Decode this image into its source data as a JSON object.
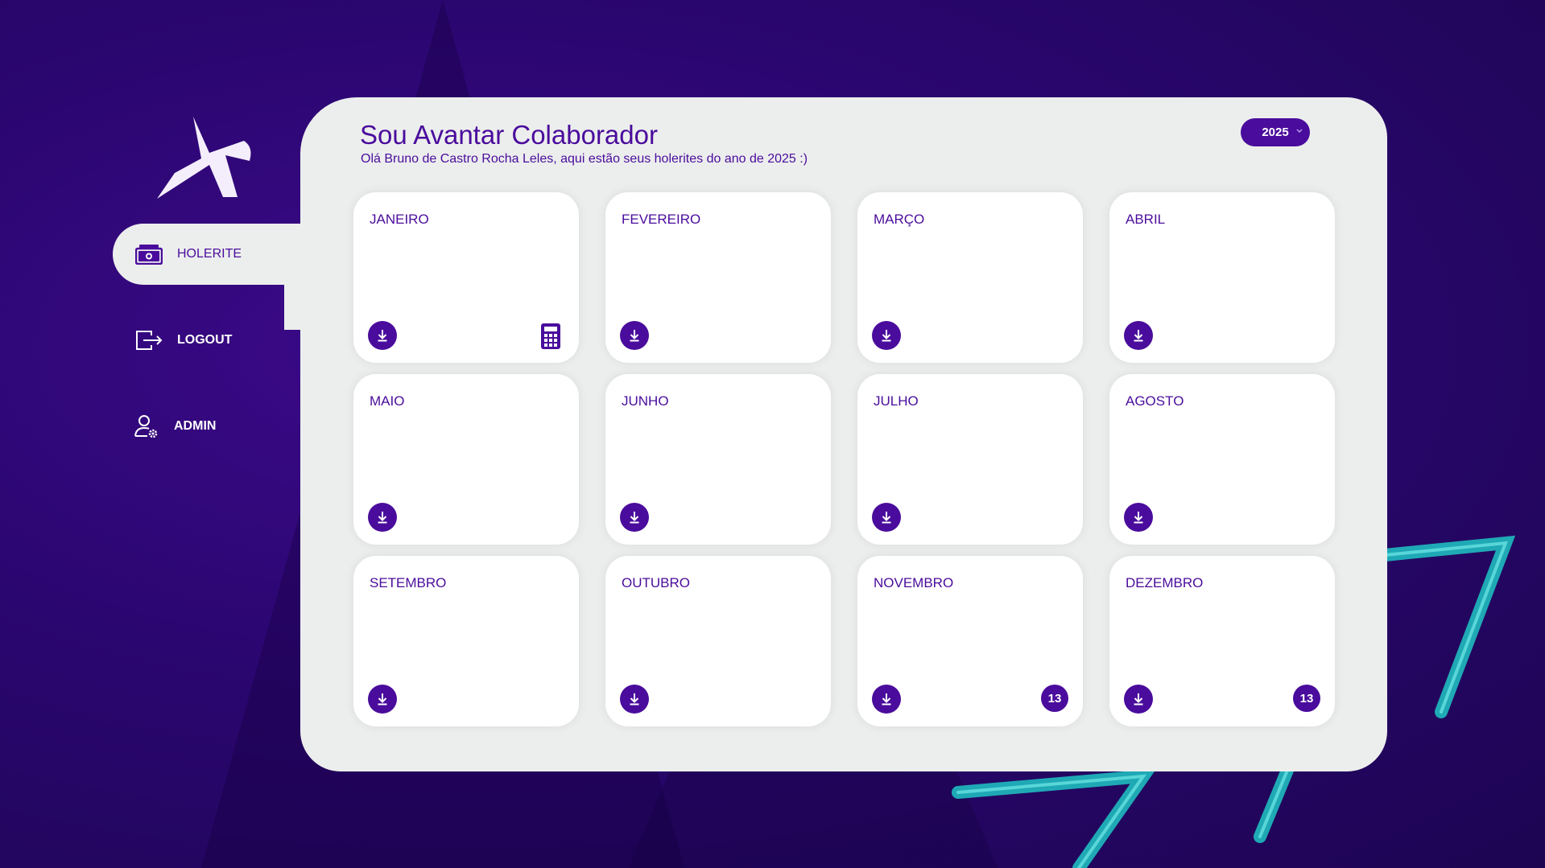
{
  "app": {
    "title": "Sou Avantar Colaborador",
    "subtitle": "Olá Bruno de Castro Rocha Leles, aqui estão seus holerites do ano de 2025 :)"
  },
  "year_select": {
    "value": "2025"
  },
  "sidebar": {
    "items": [
      {
        "label": "HOLERITE",
        "icon": "money-icon",
        "active": true
      },
      {
        "label": "LOGOUT",
        "icon": "logout-icon",
        "active": false
      },
      {
        "label": "ADMIN",
        "icon": "admin-user-gear-icon",
        "active": false
      }
    ]
  },
  "months": [
    {
      "label": "JANEIRO",
      "extra": "calculator"
    },
    {
      "label": "FEVEREIRO",
      "extra": ""
    },
    {
      "label": "MARÇO",
      "extra": ""
    },
    {
      "label": "ABRIL",
      "extra": ""
    },
    {
      "label": "MAIO",
      "extra": ""
    },
    {
      "label": "JUNHO",
      "extra": ""
    },
    {
      "label": "JULHO",
      "extra": ""
    },
    {
      "label": "AGOSTO",
      "extra": ""
    },
    {
      "label": "SETEMBRO",
      "extra": ""
    },
    {
      "label": "OUTUBRO",
      "extra": ""
    },
    {
      "label": "NOVEMBRO",
      "extra": "13"
    },
    {
      "label": "DEZEMBRO",
      "extra": "13"
    }
  ],
  "colors": {
    "accent": "#4a0c9c",
    "panel": "#eceeed",
    "background": "#2a0670",
    "neon": "#1fc7c4"
  }
}
